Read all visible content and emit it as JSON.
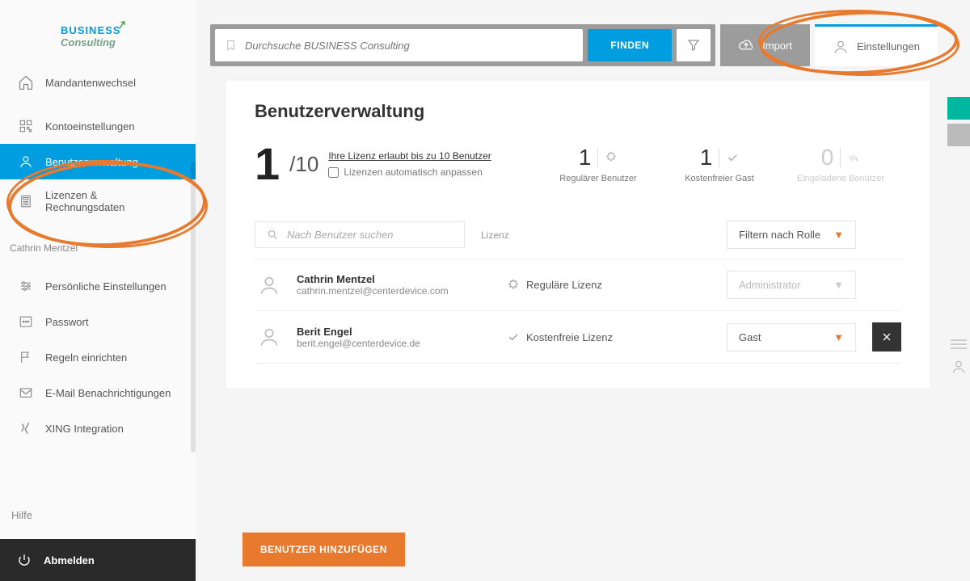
{
  "logo": {
    "line1": "BUSINESS",
    "line2": "Consulting"
  },
  "sidebar": {
    "mandant": "Mandantenwechsel",
    "account_group": [
      {
        "label": "Kontoeinstellungen"
      },
      {
        "label": "Benutzerverwaltung"
      },
      {
        "label": "Lizenzen & Rechnungsdaten"
      }
    ],
    "user_heading": "Cathrin Mentzel",
    "user_group": [
      {
        "label": "Persönliche Einstellungen"
      },
      {
        "label": "Passwort"
      },
      {
        "label": "Regeln einrichten"
      },
      {
        "label": "E-Mail Benachrichtigungen"
      },
      {
        "label": "XING Integration"
      }
    ],
    "help": "Hilfe",
    "logout": "Abmelden"
  },
  "topbar": {
    "search_placeholder": "Durchsuche BUSINESS Consulting",
    "find": "FINDEN",
    "import": "Import",
    "settings": "Einstellungen"
  },
  "page": {
    "title": "Benutzerverwaltung",
    "used": "1",
    "total": "/10",
    "license_link": "Ihre Lizenz erlaubt bis zu 10 Benutzer",
    "auto_adjust": "Lizenzen automatisch anpassen",
    "stats": {
      "regular_count": "1",
      "regular_label": "Regulärer Benutzer",
      "guest_count": "1",
      "guest_label": "Kostenfreier Gast",
      "invited_count": "0",
      "invited_label": "Eingeladene Benutzer"
    },
    "search_user_placeholder": "Nach Benutzer suchen",
    "license_header": "Lizenz",
    "role_filter": "Filtern nach Rolle",
    "users": [
      {
        "name": "Cathrin Mentzel",
        "email": "cathrin.mentzel@centerdevice.com",
        "license": "Reguläre Lizenz",
        "license_icon": "badge",
        "role": "Administrator",
        "role_muted": true,
        "deletable": false
      },
      {
        "name": "Berit Engel",
        "email": "berit.engel@centerdevice.de",
        "license": "Kostenfreie Lizenz",
        "license_icon": "check",
        "role": "Gast",
        "role_muted": false,
        "deletable": true
      }
    ],
    "add_user": "BENUTZER HINZUFÜGEN"
  }
}
